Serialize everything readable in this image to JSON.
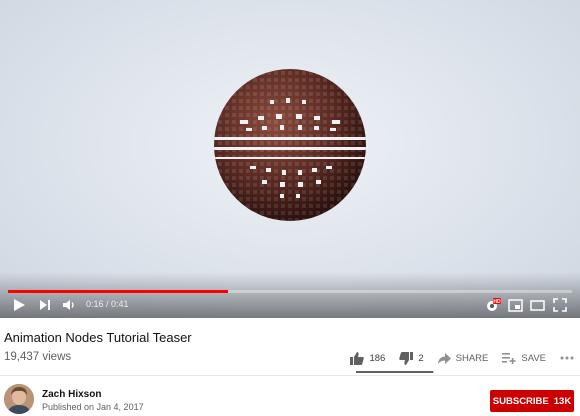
{
  "player": {
    "progress_fraction": 0.39,
    "time_current": "0:16",
    "time_separator": " / ",
    "time_total": "0:41",
    "icons": [
      "play-icon",
      "next-icon",
      "volume-icon",
      "settings-hd-icon",
      "miniplayer-icon",
      "theater-mode-icon",
      "fullscreen-icon"
    ],
    "hd_badge": "HD",
    "accent_color": "#ff0000"
  },
  "video": {
    "title": "Animation Nodes Tutorial Teaser",
    "views": "19,437 views"
  },
  "actions": {
    "likes": "186",
    "dislikes": "2",
    "share_label": "SHARE",
    "save_label": "SAVE",
    "like_fraction": 0.99
  },
  "channel": {
    "name": "Zach Hixson",
    "published": "Published on Jan 4, 2017",
    "subscribe_label": "SUBSCRIBE",
    "subscriber_count": "13K",
    "subscribe_color": "#cc0000"
  }
}
